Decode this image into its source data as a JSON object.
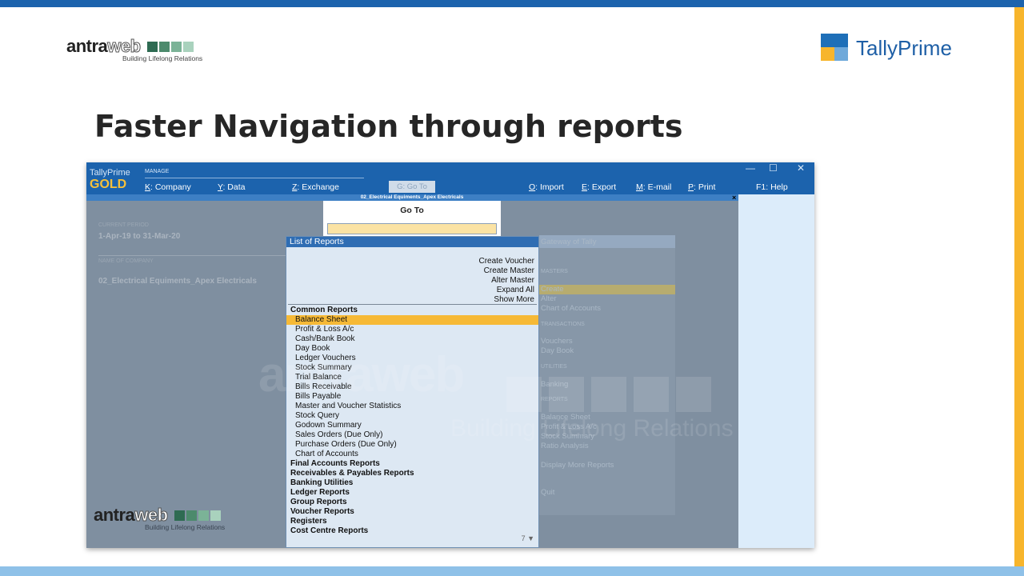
{
  "slide": {
    "title": "Faster Navigation through reports",
    "antraweb_logo": {
      "part1": "antra",
      "part2": "web",
      "tagline": "Building Lifelong Relations",
      "square_colors": [
        "#2e6b52",
        "#4c8a6c",
        "#7bb397",
        "#a9d2bd"
      ]
    },
    "tallyprime_logo": {
      "text": "TallyPrime"
    },
    "colors": {
      "top_band": "#1c63ad",
      "right_band": "#f7b52c",
      "bottom_band": "#8fc1e8"
    }
  },
  "app": {
    "brand_small": "TallyPrime",
    "brand_edition": "GOLD",
    "manage_label": "MANAGE",
    "menu": [
      {
        "key": "K",
        "label": ": Company"
      },
      {
        "key": "Y",
        "label": ": Data"
      },
      {
        "key": "Z",
        "label": ": Exchange"
      },
      {
        "key": "G",
        "label": ": Go To"
      },
      {
        "key": "O",
        "label": ": Import"
      },
      {
        "key": "E",
        "label": ": Export"
      },
      {
        "key": "M",
        "label": ": E-mail"
      },
      {
        "key": "P",
        "label": ": Print"
      },
      {
        "key": "F1",
        "label": ": Help"
      }
    ],
    "window_controls": {
      "minimize": "—",
      "maximize": "☐",
      "close": "✕"
    },
    "company_bar": "02_Electrical Equiments_Apex Electricals",
    "close_mark": "×",
    "background": {
      "current_period_label": "CURRENT PERIOD",
      "current_period_value": "1-Apr-19 to 31-Mar-20",
      "company_label": "NAME OF COMPANY",
      "company_value": "02_Electrical Equiments_Apex Electricals"
    },
    "gateway": {
      "title": "Gateway of Tally",
      "items": [
        "MASTERS",
        "Create",
        "Alter",
        "Chart of Accounts",
        "TRANSACTIONS",
        "Vouchers",
        "Day Book",
        "UTILITIES",
        "Banking",
        "REPORTS",
        "Balance Sheet",
        "Profit & Loss A/c",
        "Stock Summary",
        "Ratio Analysis",
        "Display More Reports",
        "Quit"
      ]
    },
    "goto_title": "Go To",
    "list": {
      "header": "List of Reports",
      "actions": [
        "Create Voucher",
        "Create Master",
        "Alter Master",
        "Expand All",
        "Show More"
      ],
      "group_common": "Common Reports",
      "common_reports": [
        "Balance Sheet",
        "Profit & Loss A/c",
        "Cash/Bank Book",
        "Day Book",
        "Ledger Vouchers",
        "Stock Summary",
        "Trial Balance",
        "Bills Receivable",
        "Bills Payable",
        "Master and Voucher Statistics",
        "Stock Query",
        "Godown Summary",
        "Sales Orders (Due Only)",
        "Purchase Orders (Due Only)",
        "Chart of Accounts"
      ],
      "selected": "Balance Sheet",
      "groups": [
        "Final Accounts Reports",
        "Receivables & Payables Reports",
        "Banking Utilities",
        "Ledger Reports",
        "Group Reports",
        "Voucher Reports",
        "Registers",
        "Cost Centre Reports"
      ],
      "page_indicator": "7 ▼"
    },
    "colors": {
      "header": "#1c63ad",
      "gold": "#f7c13a",
      "highlight": "#f6b936",
      "input_bg": "#fbe3a4",
      "list_bg": "#dde8f3"
    }
  }
}
